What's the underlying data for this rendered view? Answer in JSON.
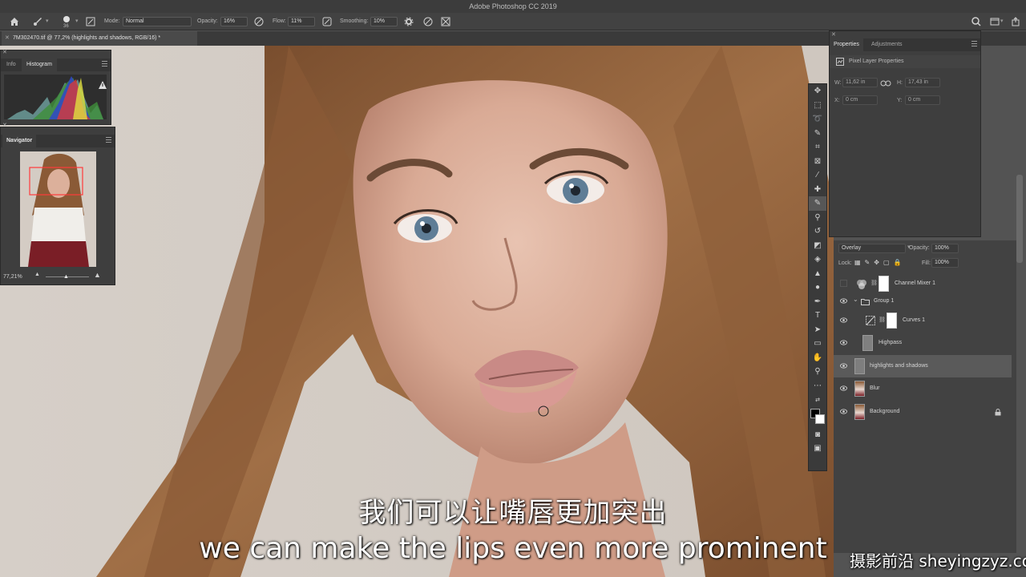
{
  "app": {
    "title": "Adobe Photoshop CC 2019"
  },
  "options": {
    "brush_size": "36",
    "mode_label": "Mode:",
    "mode_value": "Normal",
    "opacity_label": "Opacity:",
    "opacity_value": "16%",
    "flow_label": "Flow:",
    "flow_value": "11%",
    "smoothing_label": "Smoothing:",
    "smoothing_value": "10%"
  },
  "document": {
    "tab_title": "7M302470.tif @ 77,2% (highlights and shadows, RGB/16) *"
  },
  "histogram_panel": {
    "tabs": [
      "Info",
      "Histogram"
    ]
  },
  "navigator_panel": {
    "title": "Navigator",
    "zoom": "77,21%"
  },
  "properties_panel": {
    "tabs": [
      "Properties",
      "Adjustments"
    ],
    "section": "Pixel Layer Properties",
    "w_label": "W:",
    "w_value": "11,62 in",
    "h_label": "H:",
    "h_value": "17,43 in",
    "x_label": "X:",
    "x_value": "0 cm",
    "y_label": "Y:",
    "y_value": "0 cm"
  },
  "layers_panel": {
    "blend_mode": "Overlay",
    "opacity_label": "Opacity:",
    "opacity_value": "100%",
    "lock_label": "Lock:",
    "fill_label": "Fill:",
    "fill_value": "100%",
    "layers": [
      {
        "name": "Channel Mixer 1"
      },
      {
        "name": "Group 1"
      },
      {
        "name": "Curves 1"
      },
      {
        "name": "Highpass"
      },
      {
        "name": "highlights and shadows"
      },
      {
        "name": "Blur"
      },
      {
        "name": "Background"
      }
    ]
  },
  "subtitles": {
    "chinese": "我们可以让嘴唇更加突出",
    "english": "we can make the lips even more prominent"
  },
  "watermark": "摄影前沿 sheyingzyz.com",
  "colors": {
    "accent_selection": "#ff3b3b",
    "ui_dark": "#3e3e3e"
  }
}
